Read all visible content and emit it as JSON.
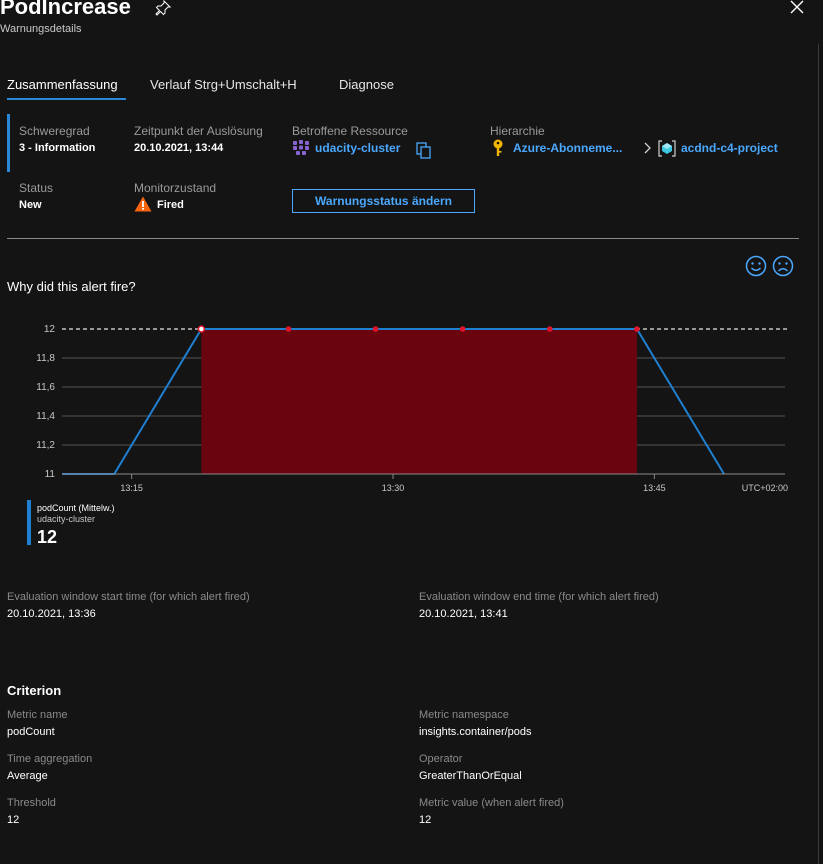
{
  "header": {
    "title": "PodIncrease",
    "subtitle": "Warnungsdetails"
  },
  "tabs": [
    {
      "label": "Zusammenfassung",
      "active": true
    },
    {
      "label": "Verlauf Strg+Umschalt+H",
      "active": false
    },
    {
      "label": "Diagnose",
      "active": false
    }
  ],
  "summary": {
    "severity_label": "Schweregrad",
    "severity_value": "3 - Information",
    "time_label": "Zeitpunkt der Auslösung",
    "time_value": "20.10.2021, 13:44",
    "resource_label": "Betroffene Ressource",
    "resource_value": "udacity-cluster",
    "hierarchy_label": "Hierarchie",
    "hierarchy_sub": "Azure-Abonneme...",
    "hierarchy_project": "acdnd-c4-project",
    "status_label": "Status",
    "status_value": "New",
    "monitor_label": "Monitorzustand",
    "monitor_value": "Fired",
    "change_button": "Warnungsstatus ändern"
  },
  "why": {
    "question": "Why did this alert fire?"
  },
  "chart_data": {
    "type": "line",
    "ylim": [
      11,
      12
    ],
    "y_ticks": [
      "12",
      "11,8",
      "11,6",
      "11,4",
      "11,2",
      "11"
    ],
    "x_ticks": [
      "13:15",
      "13:30",
      "13:45"
    ],
    "timezone": "UTC+02:00",
    "threshold": 12,
    "series": [
      {
        "name": "podCount (Mittelw.)",
        "points": [
          {
            "t": "13:11",
            "v": 11
          },
          {
            "t": "13:14",
            "v": 11
          },
          {
            "t": "13:19",
            "v": 12
          },
          {
            "t": "13:24",
            "v": 12
          },
          {
            "t": "13:29",
            "v": 12
          },
          {
            "t": "13:34",
            "v": 12
          },
          {
            "t": "13:39",
            "v": 12
          },
          {
            "t": "13:44",
            "v": 12
          },
          {
            "t": "13:49",
            "v": 11
          }
        ]
      }
    ],
    "fired_window": {
      "start": "13:19",
      "end": "13:44"
    },
    "colors": {
      "line": "#1f7fd0",
      "fired_area": "#6a0510",
      "marker": "#e0142a",
      "threshold": "#e6e6e6"
    }
  },
  "legend": {
    "name": "podCount (Mittelw.)",
    "resource": "udacity-cluster",
    "value": "12"
  },
  "evaluation": {
    "start_label": "Evaluation window start time (for which alert fired)",
    "start_value": "20.10.2021, 13:36",
    "end_label": "Evaluation window end time (for which alert fired)",
    "end_value": "20.10.2021, 13:41"
  },
  "criterion": {
    "heading": "Criterion",
    "metric_name_label": "Metric name",
    "metric_name_value": "podCount",
    "metric_namespace_label": "Metric namespace",
    "metric_namespace_value": "insights.container/pods",
    "time_aggregation_label": "Time aggregation",
    "time_aggregation_value": "Average",
    "operator_label": "Operator",
    "operator_value": "GreaterThanOrEqual",
    "threshold_label": "Threshold",
    "threshold_value": "12",
    "metric_value_label": "Metric value (when alert fired)",
    "metric_value_value": "12"
  },
  "colors": {
    "accent": "#2b88d8",
    "link": "#4aa8ff",
    "warning": "#f7630c",
    "key": "#f2b600"
  }
}
